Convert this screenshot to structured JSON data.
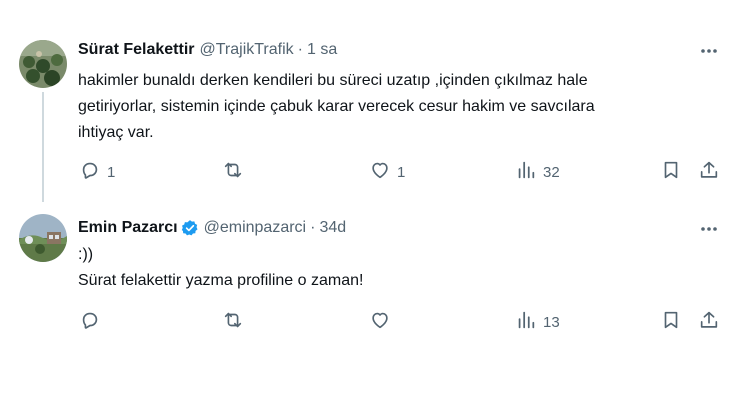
{
  "tweets": [
    {
      "name": "Sürat Felakettir",
      "handle": "@TrajikTrafik",
      "separator": "·",
      "time": "1 sa",
      "text": "hakimler bunaldı derken kendileri bu süreci uzatıp ,içinden çıkılmaz hale\ngetiriyorlar, sistemin içinde çabuk karar verecek cesur hakim ve savcılara\nihtiyaç var.",
      "replies": "1",
      "likes": "1",
      "views": "32"
    },
    {
      "name": "Emin Pazarcı",
      "handle": "@eminpazarci",
      "separator": "·",
      "time": "34d",
      "verified": true,
      "text": ":))\nSürat felakettir yazma profiline o zaman!",
      "views": "13"
    }
  ],
  "icons": {
    "reply": "reply-icon",
    "retweet": "retweet-icon",
    "like": "like-icon",
    "views": "views-icon",
    "bookmark": "bookmark-icon",
    "share": "share-icon",
    "more": "more-icon",
    "verified": "verified-badge-icon"
  },
  "colors": {
    "text": "#0f1419",
    "muted": "#536471",
    "verified": "#1d9bf0",
    "thread_line": "#cfd9de"
  }
}
